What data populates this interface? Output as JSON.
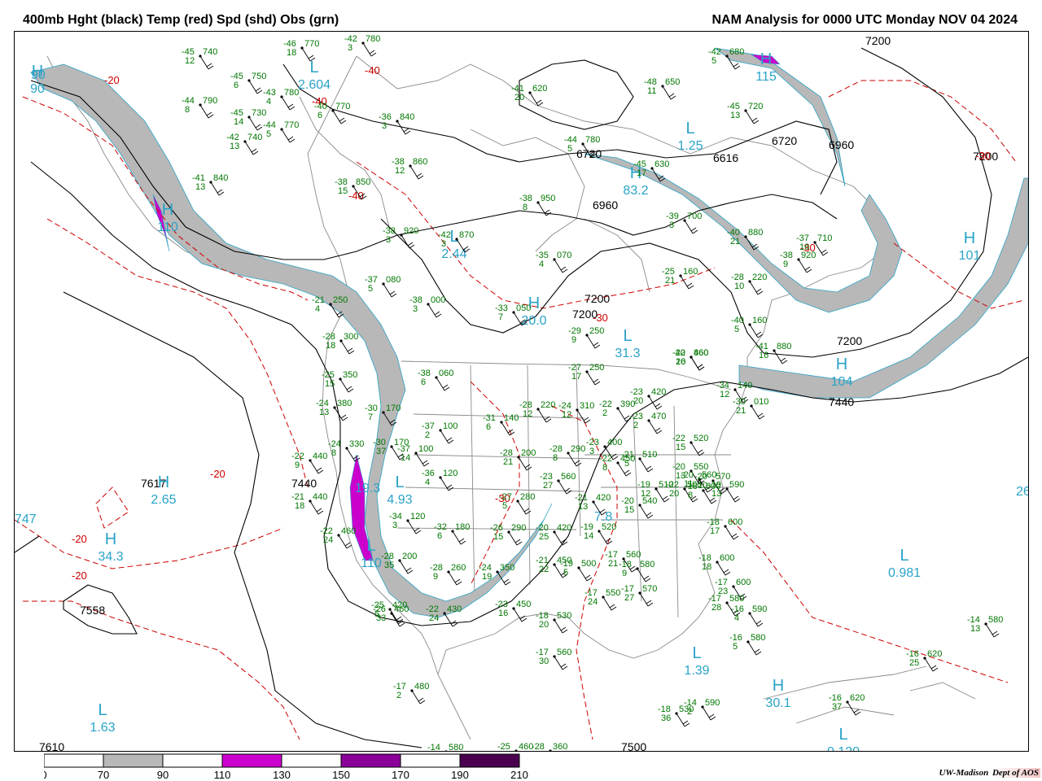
{
  "header": {
    "left_title": "400mb Hght (black) Temp (red) Spd (shd) Obs (grn)",
    "right_title": "NAM Analysis for 0000 UTC Monday  NOV 04 2024"
  },
  "colors": {
    "height": "#000000",
    "temp": "#cc0000",
    "obs": "#007700",
    "centers": "#2aa3c7",
    "spd_70": "#b8b8b8",
    "spd_110": "#cc00cc",
    "spd_150": "#8a0099",
    "spd_190": "#4a004f"
  },
  "legend": {
    "ticks": [
      "0",
      "70",
      "90",
      "110",
      "130",
      "150",
      "170",
      "190",
      "210"
    ],
    "colors": [
      "#ffffff",
      "#b8b8b8",
      "#ffffff",
      "#cc00cc",
      "#ffffff",
      "#8a0099",
      "#ffffff",
      "#4a004f"
    ]
  },
  "height_labels": [
    "7200",
    "6720",
    "6720",
    "6616",
    "6960",
    "7200",
    "6960",
    "7200",
    "7200",
    "7200",
    "7440",
    "7440",
    "7617",
    "7558",
    "7610",
    "7500"
  ],
  "temp_labels": [
    "-20",
    "-40",
    "-40",
    "-40",
    "-30",
    "-30",
    "-30",
    "-20",
    "-20",
    "-20",
    "-30"
  ],
  "centers": [
    {
      "type": "H",
      "value": "115"
    },
    {
      "type": "L",
      "value": "2.604"
    },
    {
      "type": "L",
      "value": "1.25"
    },
    {
      "type": "H",
      "value": "83.2"
    },
    {
      "type": "L",
      "value": "2.44"
    },
    {
      "type": "H",
      "value": "101"
    },
    {
      "type": "H",
      "value": "110"
    },
    {
      "type": "H",
      "value": "20.0"
    },
    {
      "type": "L",
      "value": "31.3"
    },
    {
      "type": "H",
      "value": "104"
    },
    {
      "type": "H",
      "value": "2.65"
    },
    {
      "type": "H",
      "value": "34.3"
    },
    {
      "type": "L",
      "value": "4.93"
    },
    {
      "type": "L",
      "value": "0.981"
    },
    {
      "type": "L",
      "value": "1.39"
    },
    {
      "type": "H",
      "value": "30.1"
    },
    {
      "type": "L",
      "value": "1.63"
    },
    {
      "type": "L",
      "value": "0.120"
    },
    {
      "type": "H",
      "value": "90"
    },
    {
      "type": "L",
      "value": "110"
    }
  ],
  "center_values_misc": [
    "747",
    "7.8",
    "19.3",
    "26",
    "90"
  ],
  "stations": [
    {
      "t": "-45",
      "h": "740",
      "d": "12"
    },
    {
      "t": "-45",
      "h": "750",
      "d": "6"
    },
    {
      "t": "-46",
      "h": "770",
      "d": "18"
    },
    {
      "t": "-42",
      "h": "780",
      "d": "3"
    },
    {
      "t": "-44",
      "h": "790",
      "d": "8"
    },
    {
      "t": "-45",
      "h": "730",
      "d": "14"
    },
    {
      "t": "-42",
      "h": "740",
      "d": "13"
    },
    {
      "t": "-44",
      "h": "770",
      "d": "5"
    },
    {
      "t": "-43",
      "h": "780",
      "d": "4"
    },
    {
      "t": "-40",
      "h": "770",
      "d": "6"
    },
    {
      "t": "-36",
      "h": "840",
      "d": "3"
    },
    {
      "t": "-38",
      "h": "860",
      "d": "12"
    },
    {
      "t": "-41",
      "h": "840",
      "d": "13"
    },
    {
      "t": "-38",
      "h": "850",
      "d": "15"
    },
    {
      "t": "-38",
      "h": "920",
      "d": "3"
    },
    {
      "t": "-42",
      "h": "870",
      "d": "3"
    },
    {
      "t": "-38",
      "h": "950",
      "d": "8"
    },
    {
      "t": "-35",
      "h": "070",
      "d": "4"
    },
    {
      "t": "-37",
      "h": "080",
      "d": "5"
    },
    {
      "t": "-38",
      "h": "000",
      "d": "3"
    },
    {
      "t": "-33",
      "h": "050",
      "d": "7"
    },
    {
      "t": "-29",
      "h": "250",
      "d": "9"
    },
    {
      "t": "-27",
      "h": "250",
      "d": "17"
    },
    {
      "t": "-21",
      "h": "250",
      "d": "4"
    },
    {
      "t": "-28",
      "h": "300",
      "d": "18"
    },
    {
      "t": "-25",
      "h": "350",
      "d": "15"
    },
    {
      "t": "-24",
      "h": "380",
      "d": "13"
    },
    {
      "t": "-24",
      "h": "330",
      "d": "8"
    },
    {
      "t": "-22",
      "h": "440",
      "d": "9"
    },
    {
      "t": "-21",
      "h": "440",
      "d": "18"
    },
    {
      "t": "-22",
      "h": "460",
      "d": "24"
    },
    {
      "t": "-38",
      "h": "060",
      "d": "6"
    },
    {
      "t": "-30",
      "h": "170",
      "d": "7"
    },
    {
      "t": "-37",
      "h": "100",
      "d": "2"
    },
    {
      "t": "-31",
      "h": "140",
      "d": "6"
    },
    {
      "t": "-30",
      "h": "170",
      "d": "37"
    },
    {
      "t": "-37",
      "h": "100",
      "d": "14"
    },
    {
      "t": "-36",
      "h": "120",
      "d": "4"
    },
    {
      "t": "-34",
      "h": "120",
      "d": "3"
    },
    {
      "t": "-32",
      "h": "180",
      "d": "6"
    },
    {
      "t": "-28",
      "h": "200",
      "d": "35"
    },
    {
      "t": "-28",
      "h": "260",
      "d": "9"
    },
    {
      "t": "-24",
      "h": "350",
      "d": "19"
    },
    {
      "t": "-26",
      "h": "460",
      "d": "33"
    },
    {
      "t": "-22",
      "h": "430",
      "d": "24"
    },
    {
      "t": "-23",
      "h": "450",
      "d": "16"
    },
    {
      "t": "-28",
      "h": "220",
      "d": "12"
    },
    {
      "t": "-28",
      "h": "200",
      "d": "21"
    },
    {
      "t": "-28",
      "h": "290",
      "d": "8"
    },
    {
      "t": "-27",
      "h": "280",
      "d": "5"
    },
    {
      "t": "-26",
      "h": "290",
      "d": "15"
    },
    {
      "t": "-20",
      "h": "420",
      "d": "25"
    },
    {
      "t": "-21",
      "h": "450",
      "d": "22"
    },
    {
      "t": "-24",
      "h": "310",
      "d": "12"
    },
    {
      "t": "-22",
      "h": "390",
      "d": "2"
    },
    {
      "t": "-23",
      "h": "420",
      "d": "20"
    },
    {
      "t": "-23",
      "h": "470",
      "d": "2"
    },
    {
      "t": "-23",
      "h": "400",
      "d": "3"
    },
    {
      "t": "-22",
      "h": "450",
      "d": "8"
    },
    {
      "t": "-21",
      "h": "420",
      "d": "13"
    },
    {
      "t": "-23",
      "h": "560",
      "d": "27"
    },
    {
      "t": "-19",
      "h": "520",
      "d": "14"
    },
    {
      "t": "-19",
      "h": "500",
      "d": "5"
    },
    {
      "t": "-18",
      "h": "530",
      "d": "20"
    },
    {
      "t": "-17",
      "h": "560",
      "d": "30"
    },
    {
      "t": "-17",
      "h": "550",
      "d": "24"
    },
    {
      "t": "-17",
      "h": "570",
      "d": "27"
    },
    {
      "t": "-17",
      "h": "560",
      "d": "21"
    },
    {
      "t": "-20",
      "h": "540",
      "d": "15"
    },
    {
      "t": "-19",
      "h": "510",
      "d": "12"
    },
    {
      "t": "-21",
      "h": "510",
      "d": "5"
    },
    {
      "t": "-18",
      "h": "580",
      "d": "9"
    },
    {
      "t": "-22",
      "h": "500",
      "d": "20"
    },
    {
      "t": "-22",
      "h": "520",
      "d": "15"
    },
    {
      "t": "-20",
      "h": "550",
      "d": "13"
    },
    {
      "t": "-20",
      "h": "560",
      "d": "11"
    },
    {
      "t": "-20",
      "h": "570",
      "d": "10"
    },
    {
      "t": "-19",
      "h": "590",
      "d": "13"
    },
    {
      "t": "-18",
      "h": "600",
      "d": "8"
    },
    {
      "t": "-18",
      "h": "600",
      "d": "17"
    },
    {
      "t": "-18",
      "h": "600",
      "d": "18"
    },
    {
      "t": "-17",
      "h": "600",
      "d": "23"
    },
    {
      "t": "-17",
      "h": "580",
      "d": "28"
    },
    {
      "t": "-16",
      "h": "590",
      "d": "4"
    },
    {
      "t": "-16",
      "h": "580",
      "d": "5"
    },
    {
      "t": "-14",
      "h": "580",
      "d": "13"
    },
    {
      "t": "-16",
      "h": "620",
      "d": "25"
    },
    {
      "t": "-16",
      "h": "620",
      "d": "37"
    },
    {
      "t": "-18",
      "h": "530",
      "d": "36"
    },
    {
      "t": "-14",
      "h": "590",
      "d": "2"
    },
    {
      "t": "-17",
      "h": "480",
      "d": "2"
    },
    {
      "t": "-14",
      "h": "580",
      "d": "2"
    },
    {
      "t": "-25",
      "h": "460",
      "d": "25"
    },
    {
      "t": "-28",
      "h": "360",
      "d": "10"
    },
    {
      "t": "-25",
      "h": "420",
      "d": "5"
    },
    {
      "t": "-20",
      "h": "460",
      "d": "20"
    },
    {
      "t": "-34",
      "h": "140",
      "d": "12"
    },
    {
      "t": "-30",
      "h": "010",
      "d": "21"
    },
    {
      "t": "-25",
      "h": "160",
      "d": "21"
    },
    {
      "t": "-28",
      "h": "220",
      "d": "10"
    },
    {
      "t": "-40",
      "h": "160",
      "d": "5"
    },
    {
      "t": "-42",
      "h": "860",
      "d": "16"
    },
    {
      "t": "-41",
      "h": "880",
      "d": "16"
    },
    {
      "t": "-40",
      "h": "880",
      "d": "21"
    },
    {
      "t": "-38",
      "h": "920",
      "d": "9"
    },
    {
      "t": "-37",
      "h": "710",
      "d": "16"
    },
    {
      "t": "-39",
      "h": "700",
      "d": "3"
    },
    {
      "t": "-42",
      "h": "680",
      "d": "5"
    },
    {
      "t": "-48",
      "h": "650",
      "d": "11"
    },
    {
      "t": "-45",
      "h": "720",
      "d": "13"
    },
    {
      "t": "-41",
      "h": "620",
      "d": "20"
    },
    {
      "t": "-44",
      "h": "780",
      "d": "5"
    },
    {
      "t": "-45",
      "h": "630",
      "d": "17"
    }
  ],
  "credit": {
    "org": "UW-Madison",
    "dept": "Dept of AOS"
  }
}
